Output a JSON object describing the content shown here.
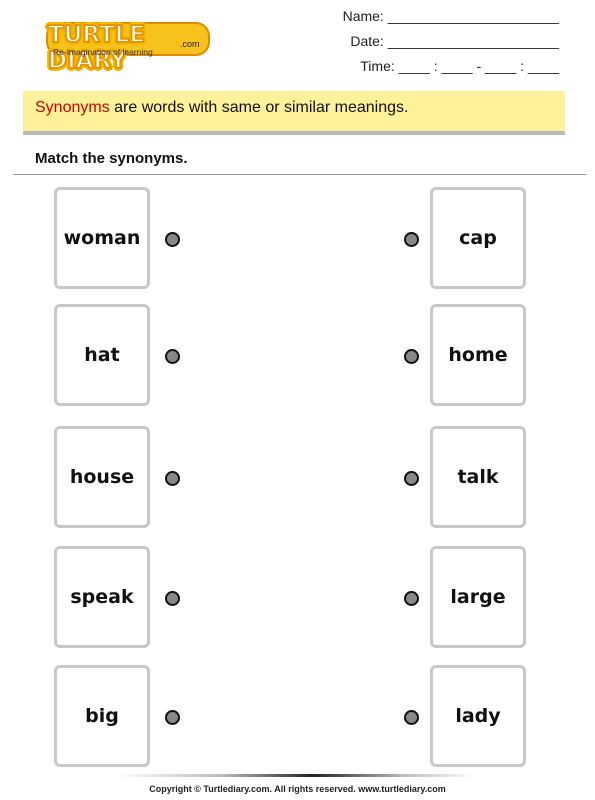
{
  "header": {
    "logo_text": "TURTLE DIARY",
    "logo_suffix": ".com",
    "tagline": "Re-Imagination of learning",
    "name_label": "Name: ______________________",
    "date_label": "Date: ______________________",
    "time_label": "Time: ____ : ____ - ____ : ____"
  },
  "banner": {
    "keyword": "Synonyms",
    "text": " are words with same or similar meanings.",
    "keyword_color": "#d10000",
    "background": "#fdf19a"
  },
  "instruction": "Match the synonyms.",
  "left_words": [
    "woman",
    "hat",
    "house",
    "speak",
    "big"
  ],
  "right_words": [
    "cap",
    "home",
    "talk",
    "large",
    "lady"
  ],
  "footer": "Copyright © Turtlediary.com. All rights reserved. www.turtlediary.com"
}
